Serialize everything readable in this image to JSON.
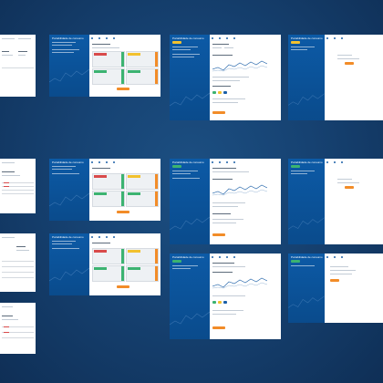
{
  "app": {
    "title": "Portabilidade de consumo"
  },
  "nav_tabs": [
    "",
    "",
    "",
    "",
    ""
  ],
  "colors": {
    "background": "#164272",
    "sidebar": "#0c5aa6",
    "accent_orange": "#f28c28",
    "status_green": "#3cb371",
    "status_red": "#d94b4b",
    "status_yellow": "#f2c12e"
  },
  "frames": [
    {
      "id": "a1",
      "title": "Portabilidade de consumo"
    },
    {
      "id": "b1",
      "title": "Portabilidade de consumo"
    },
    {
      "id": "c1",
      "title": "Portabilidade de consumo"
    },
    {
      "id": "a2",
      "title": "Portabilidade de consumo"
    },
    {
      "id": "b2",
      "title": "Portabilidade de consumo"
    },
    {
      "id": "c2",
      "title": "Portabilidade de consumo"
    },
    {
      "id": "b3",
      "title": "Portabilidade de consumo"
    },
    {
      "id": "c3",
      "title": "Portabilidade de consumo"
    }
  ]
}
